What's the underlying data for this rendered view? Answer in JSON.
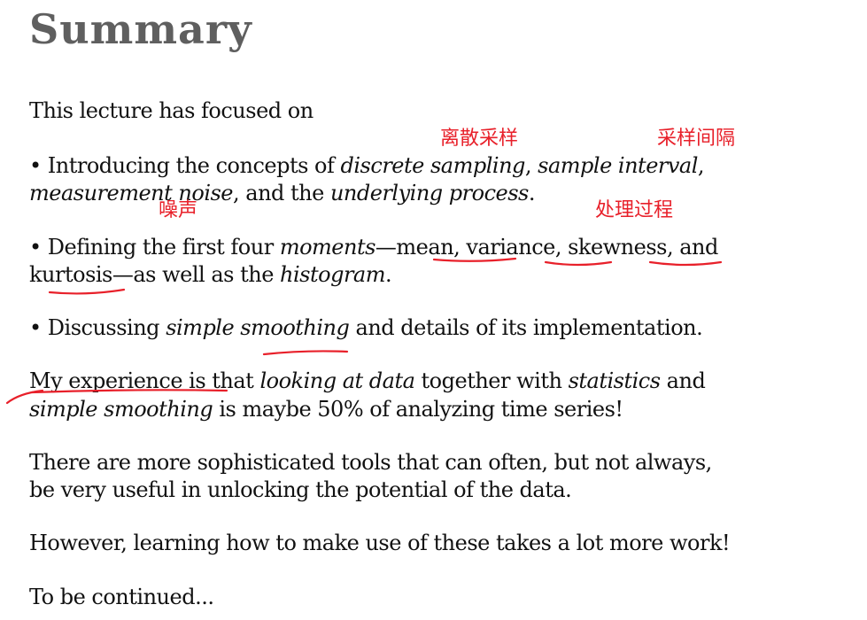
{
  "title": "Summary",
  "p1": "This lecture has focused on",
  "b1": {
    "bullet": "•",
    "t1": " Introducing the concepts of ",
    "e1": "discrete sampling",
    "t2": ", ",
    "e2": "sample interval",
    "t3": ",",
    "e3": "measurement noise",
    "t4": ", and the ",
    "e4": "underlying process",
    "t5": "."
  },
  "b2": {
    "bullet": "•",
    "t1": " Defining the first four ",
    "e1": "moments",
    "t2": "—mean, variance, skewness, and",
    "t3": "kurtosis—as well as the ",
    "e2": "histogram",
    "t4": "."
  },
  "b3": {
    "bullet": "•",
    "t1": " Discussing ",
    "e1": "simple smoothing",
    "t2": " and details of its implementation."
  },
  "p2": {
    "t1": "My experience is that ",
    "e1": "looking at data",
    "t2": " together with ",
    "e2": "statistics",
    "t3": " and",
    "e3": "simple smoothing",
    "t4": " is maybe 50% of analyzing time series!"
  },
  "p3": {
    "l1": "There are more sophisticated tools that can often, but not always,",
    "l2": "be very useful in unlocking the potential of the data."
  },
  "p4": "However, learning how to make use of these takes a lot more work!",
  "p5": "To be continued...",
  "notes": {
    "discrete_sampling": "离散采样",
    "sample_interval": "采样间隔",
    "measurement_noise": "噪声",
    "underlying_process": "处理过程"
  },
  "colors": {
    "title": "#5f5f5f",
    "text": "#111111",
    "annotation": "#e8202a"
  }
}
